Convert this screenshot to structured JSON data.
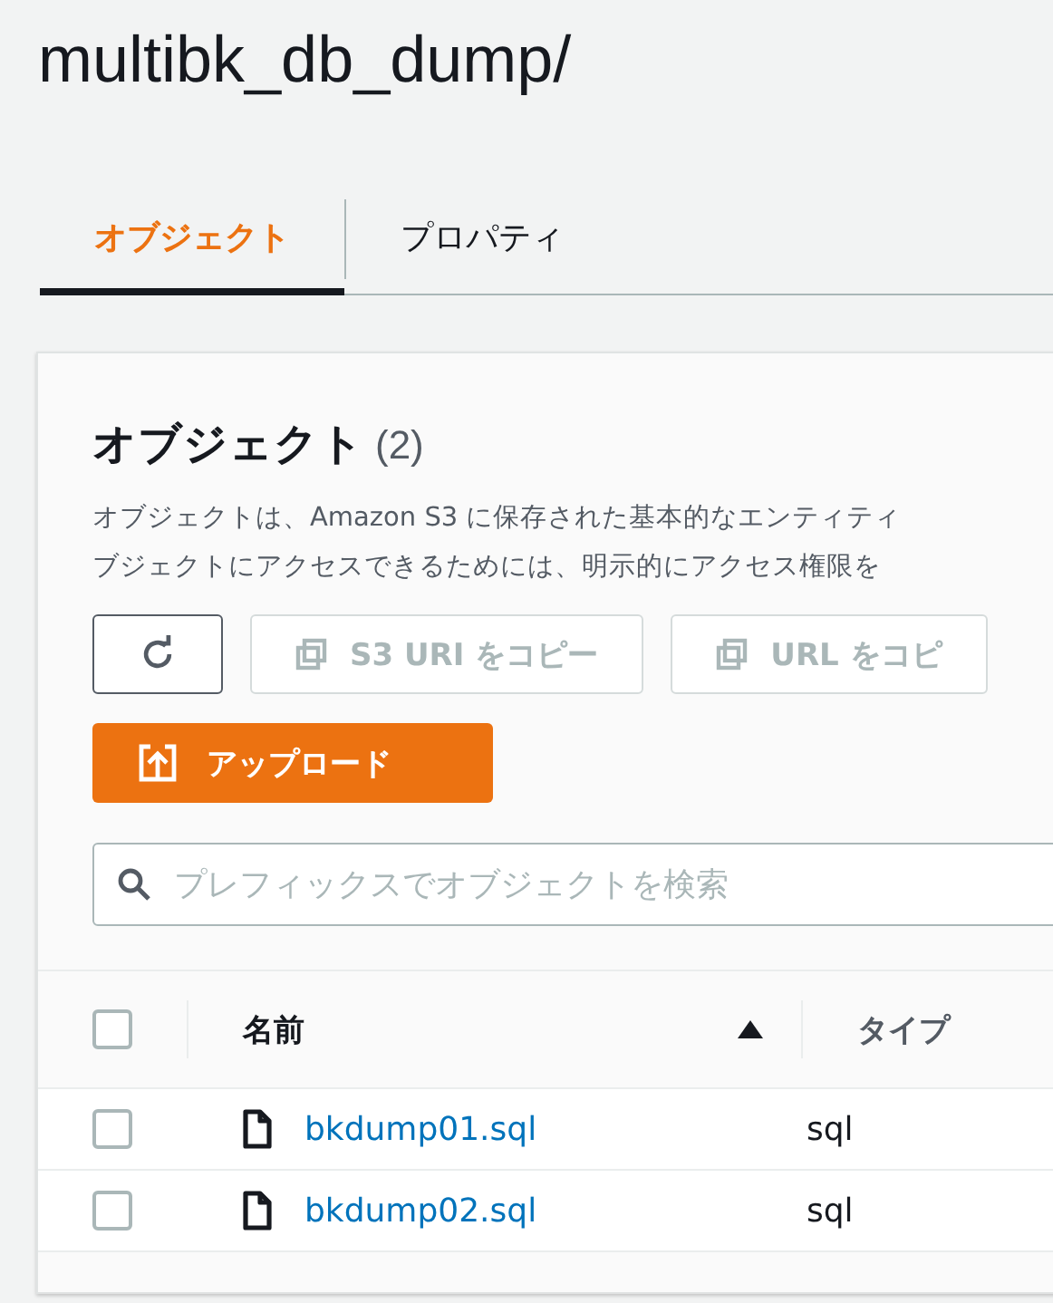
{
  "title": "multibk_db_dump/",
  "tabs": [
    {
      "label": "オブジェクト",
      "selected": true
    },
    {
      "label": "プロパティ",
      "selected": false
    }
  ],
  "panel": {
    "heading": "オブジェクト",
    "count": "(2)",
    "description": [
      "オブジェクトは、Amazon S3 に保存された基本的なエンティティ",
      "ブジェクトにアクセスできるためには、明示的にアクセス権限を"
    ],
    "actions": [
      {
        "kind": "refresh",
        "disabled": false
      },
      {
        "kind": "copy",
        "label": "S3 URI をコピー",
        "disabled": true
      },
      {
        "kind": "copy",
        "label": "URL をコピ",
        "disabled": true
      }
    ],
    "upload": "アップロード",
    "search": {
      "placeholder": "プレフィックスでオブジェクトを検索"
    },
    "table": {
      "select_all": {
        "checked": false
      },
      "columns": [
        {
          "label": "名前",
          "sorted": true
        },
        {
          "label": "タイプ",
          "sorted": false
        }
      ],
      "rows": [
        {
          "checked": false,
          "name": "bkdump01.sql",
          "type": "sql"
        },
        {
          "checked": false,
          "name": "bkdump02.sql",
          "type": "sql"
        }
      ]
    }
  }
}
